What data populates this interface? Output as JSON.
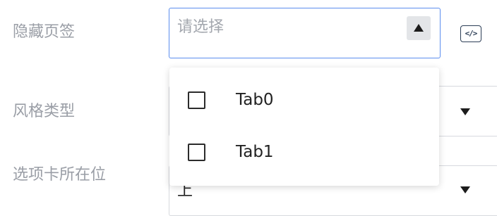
{
  "form": {
    "rows": [
      {
        "label": "隐藏页签",
        "placeholder": "请选择"
      },
      {
        "label": "风格类型"
      },
      {
        "label": "选项卡所在位",
        "value": "上"
      }
    ]
  },
  "dropdown": {
    "options": [
      {
        "label": "Tab0",
        "checked": false
      },
      {
        "label": "Tab1",
        "checked": false
      }
    ]
  },
  "icons": {
    "code_button": "</>",
    "arrow_up": "caret-up-icon",
    "arrow_down": "caret-down-icon",
    "checkbox": "checkbox-icon"
  },
  "colors": {
    "active_border": "#5b8def",
    "label": "#9a9ea6",
    "placeholder": "#a3a7ae"
  }
}
